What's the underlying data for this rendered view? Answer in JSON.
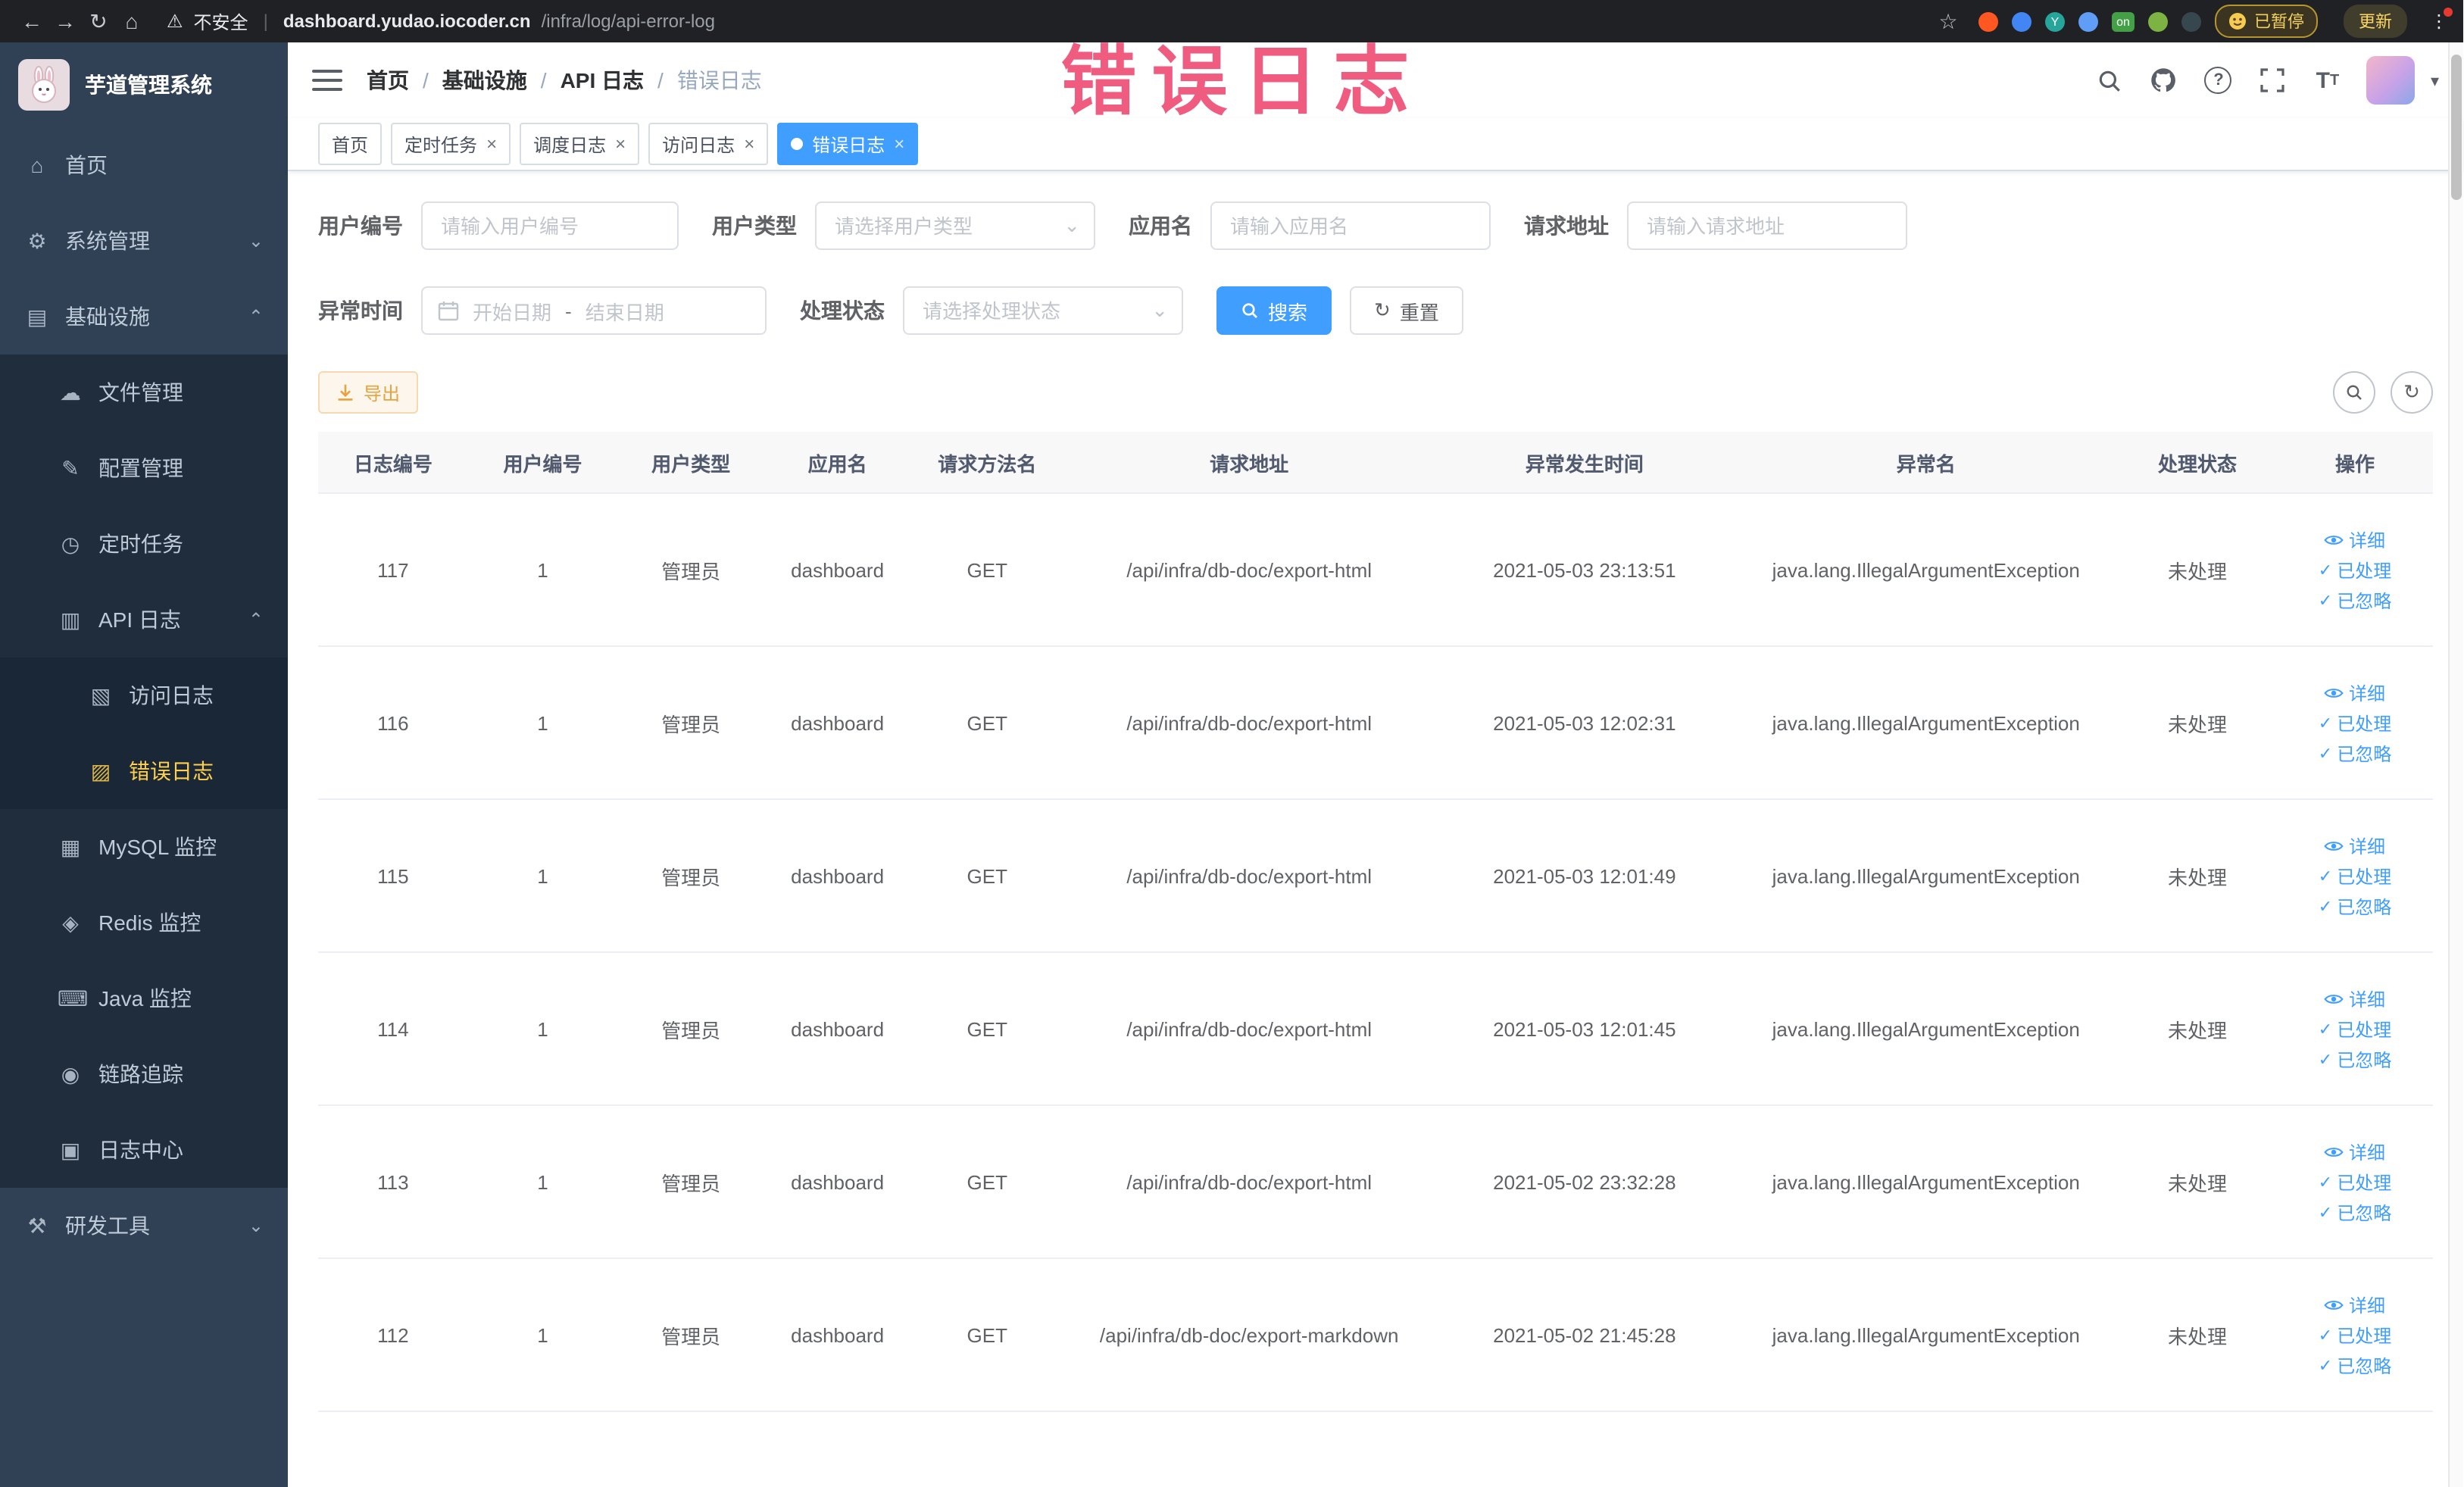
{
  "watermark": "错误日志",
  "browser": {
    "security_warning": "不安全",
    "url_host": "dashboard.yudao.iocoder.cn",
    "url_path": "/infra/log/api-error-log",
    "ext_on_badge": "on",
    "ext_y_badge": "Y",
    "paused_badge": "已暂停",
    "update_button": "更新"
  },
  "icons": {
    "back": "←",
    "forward": "→",
    "reload": "↻",
    "home": "⌂",
    "warning": "⚠",
    "star": "☆",
    "overflow": "⋮",
    "menu_home": "⌂",
    "menu_system": "⚙",
    "menu_infra": "▤",
    "menu_file": "☁",
    "menu_config": "✎",
    "menu_job": "◷",
    "menu_api_log": "▥",
    "menu_access_log": "▧",
    "menu_error_log": "▨",
    "menu_mysql": "▦",
    "menu_redis": "◈",
    "menu_java": "⌨",
    "menu_trace": "◉",
    "menu_log_center": "▣",
    "menu_tools": "⚒",
    "chevron_down": "⌄",
    "chevron_up": "⌃",
    "check": "✓",
    "tab_close": "×",
    "caret_down": "▾",
    "refresh": "↻",
    "question": "?"
  },
  "sidebar": {
    "logo_title": "芋道管理系统",
    "items": [
      {
        "label": "首页"
      },
      {
        "label": "系统管理"
      },
      {
        "label": "基础设施"
      },
      {
        "label": "文件管理"
      },
      {
        "label": "配置管理"
      },
      {
        "label": "定时任务"
      },
      {
        "label": "API 日志"
      },
      {
        "label": "访问日志"
      },
      {
        "label": "错误日志"
      },
      {
        "label": "MySQL 监控"
      },
      {
        "label": "Redis 监控"
      },
      {
        "label": "Java 监控"
      },
      {
        "label": "链路追踪"
      },
      {
        "label": "日志中心"
      },
      {
        "label": "研发工具"
      }
    ]
  },
  "breadcrumb": [
    "首页",
    "基础设施",
    "API 日志",
    "错误日志"
  ],
  "tabs": [
    {
      "label": "首页",
      "closable": false,
      "active": false
    },
    {
      "label": "定时任务",
      "closable": true,
      "active": false
    },
    {
      "label": "调度日志",
      "closable": true,
      "active": false
    },
    {
      "label": "访问日志",
      "closable": true,
      "active": false
    },
    {
      "label": "错误日志",
      "closable": true,
      "active": true
    }
  ],
  "filters": {
    "user_id_label": "用户编号",
    "user_id_placeholder": "请输入用户编号",
    "user_type_label": "用户类型",
    "user_type_placeholder": "请选择用户类型",
    "app_name_label": "应用名",
    "app_name_placeholder": "请输入应用名",
    "request_url_label": "请求地址",
    "request_url_placeholder": "请输入请求地址",
    "exception_time_label": "异常时间",
    "date_start_placeholder": "开始日期",
    "date_separator": "-",
    "date_end_placeholder": "结束日期",
    "process_status_label": "处理状态",
    "process_status_placeholder": "请选择处理状态",
    "search_button": "搜索",
    "reset_button": "重置"
  },
  "toolbar": {
    "export_button": "导出"
  },
  "table": {
    "headers": [
      "日志编号",
      "用户编号",
      "用户类型",
      "应用名",
      "请求方法名",
      "请求地址",
      "异常发生时间",
      "异常名",
      "处理状态",
      "操作"
    ],
    "action_labels": [
      "详细",
      "已处理",
      "已忽略"
    ],
    "rows": [
      {
        "id": "117",
        "user_id": "1",
        "user_type": "管理员",
        "app": "dashboard",
        "method": "GET",
        "url": "/api/infra/db-doc/export-html",
        "time": "2021-05-03 23:13:51",
        "exception": "java.lang.IllegalArgumentException",
        "status": "未处理"
      },
      {
        "id": "116",
        "user_id": "1",
        "user_type": "管理员",
        "app": "dashboard",
        "method": "GET",
        "url": "/api/infra/db-doc/export-html",
        "time": "2021-05-03 12:02:31",
        "exception": "java.lang.IllegalArgumentException",
        "status": "未处理"
      },
      {
        "id": "115",
        "user_id": "1",
        "user_type": "管理员",
        "app": "dashboard",
        "method": "GET",
        "url": "/api/infra/db-doc/export-html",
        "time": "2021-05-03 12:01:49",
        "exception": "java.lang.IllegalArgumentException",
        "status": "未处理"
      },
      {
        "id": "114",
        "user_id": "1",
        "user_type": "管理员",
        "app": "dashboard",
        "method": "GET",
        "url": "/api/infra/db-doc/export-html",
        "time": "2021-05-03 12:01:45",
        "exception": "java.lang.IllegalArgumentException",
        "status": "未处理"
      },
      {
        "id": "113",
        "user_id": "1",
        "user_type": "管理员",
        "app": "dashboard",
        "method": "GET",
        "url": "/api/infra/db-doc/export-html",
        "time": "2021-05-02 23:32:28",
        "exception": "java.lang.IllegalArgumentException",
        "status": "未处理"
      },
      {
        "id": "112",
        "user_id": "1",
        "user_type": "管理员",
        "app": "dashboard",
        "method": "GET",
        "url": "/api/infra/db-doc/export-markdown",
        "time": "2021-05-02 21:45:28",
        "exception": "java.lang.IllegalArgumentException",
        "status": "未处理"
      }
    ]
  }
}
